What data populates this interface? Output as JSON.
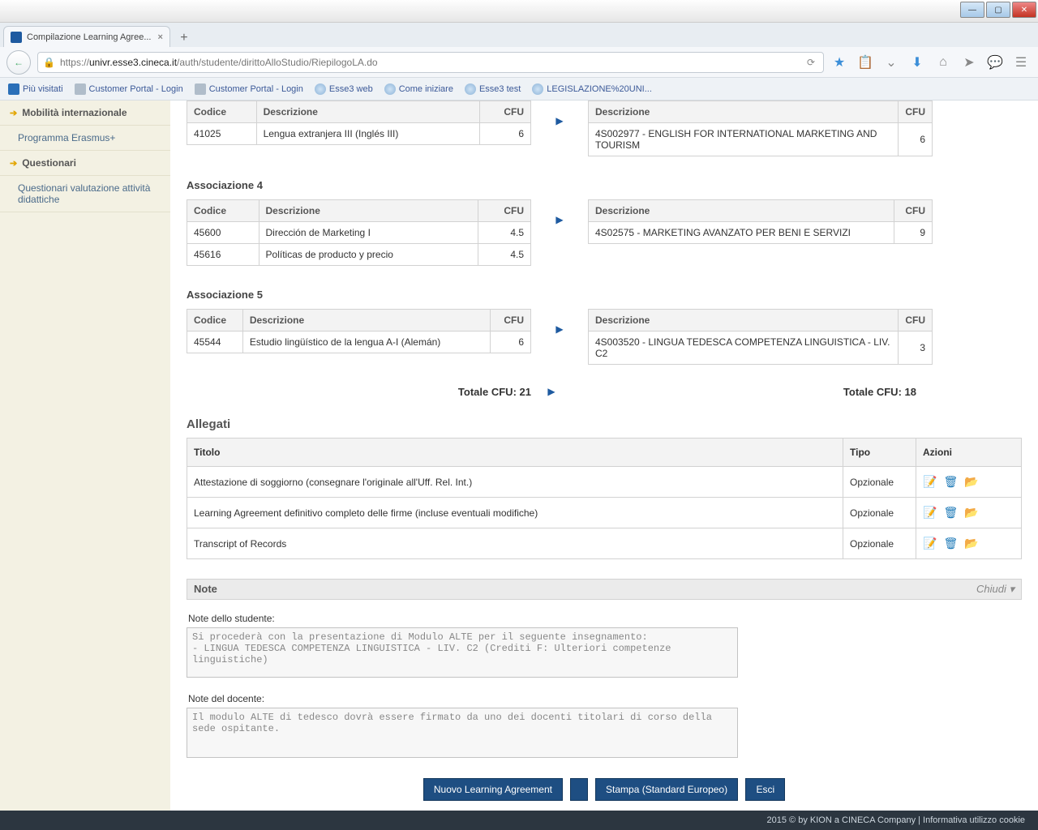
{
  "browser": {
    "tab_title": "Compilazione Learning Agree...",
    "url_prefix": "https://",
    "url_host": "univr.esse3.cineca.it",
    "url_path": "/auth/studente/dirittoAlloStudio/RiepilogoLA.do"
  },
  "bookmarks": [
    "Più visitati",
    "Customer Portal - Login",
    "Customer Portal - Login",
    "Esse3 web",
    "Come iniziare",
    "Esse3 test",
    "LEGISLAZIONE%20UNI..."
  ],
  "sidebar": {
    "mobility": "Mobilità internazionale",
    "erasmus": "Programma Erasmus+",
    "questionari": "Questionari",
    "quest_val": "Questionari valutazione attività didattiche"
  },
  "headers": {
    "codice": "Codice",
    "descr": "Descrizione",
    "cfu": "CFU",
    "titolo": "Titolo",
    "tipo": "Tipo",
    "azioni": "Azioni"
  },
  "assoc_top": {
    "left": {
      "code": "41025",
      "desc": "Lengua extranjera III (Inglés III)",
      "cfu": "6"
    },
    "right": {
      "desc": "4S002977 - ENGLISH FOR INTERNATIONAL MARKETING AND TOURISM",
      "cfu": "6"
    }
  },
  "assoc4": {
    "title": "Associazione 4",
    "left": [
      {
        "code": "45600",
        "desc": "Dirección de Marketing I",
        "cfu": "4.5"
      },
      {
        "code": "45616",
        "desc": "Políticas de producto y precio",
        "cfu": "4.5"
      }
    ],
    "right": {
      "desc": "4S02575 - MARKETING AVANZATO PER BENI E SERVIZI",
      "cfu": "9"
    }
  },
  "assoc5": {
    "title": "Associazione 5",
    "left": {
      "code": "45544",
      "desc": "Estudio lingüístico de la lengua A-I (Alemán)",
      "cfu": "6"
    },
    "right": {
      "desc": "4S003520 - LINGUA TEDESCA COMPETENZA LINGUISTICA - LIV. C2",
      "cfu": "3"
    }
  },
  "totals": {
    "left_label": "Totale CFU:",
    "left": "21",
    "right_label": "Totale CFU:",
    "right": "18"
  },
  "allegati": {
    "title": "Allegati",
    "rows": [
      {
        "t": "Attestazione di soggiorno (consegnare l'originale all'Uff. Rel. Int.)",
        "tipo": "Opzionale"
      },
      {
        "t": "Learning Agreement definitivo completo delle firme (incluse eventuali modifiche)",
        "tipo": "Opzionale"
      },
      {
        "t": "Transcript of Records",
        "tipo": "Opzionale"
      }
    ]
  },
  "note": {
    "title": "Note",
    "chiudi": "Chiudi",
    "stud_label": "Note dello studente:",
    "stud_text": "Si procederà con la presentazione di Modulo ALTE per il seguente insegnamento:\n- LINGUA TEDESCA COMPETENZA LINGUISTICA - LIV. C2 (Crediti F: Ulteriori competenze linguistiche)",
    "doc_label": "Note del docente:",
    "doc_text": "Il modulo ALTE di tedesco dovrà essere firmato da uno dei docenti titolari di corso della sede ospitante."
  },
  "buttons": {
    "nuovo": "Nuovo Learning Agreement",
    "stampa": "Stampa (Standard Europeo)",
    "esci": "Esci"
  },
  "footer": "2015 © by KION a CINECA Company | Informativa utilizzo cookie"
}
